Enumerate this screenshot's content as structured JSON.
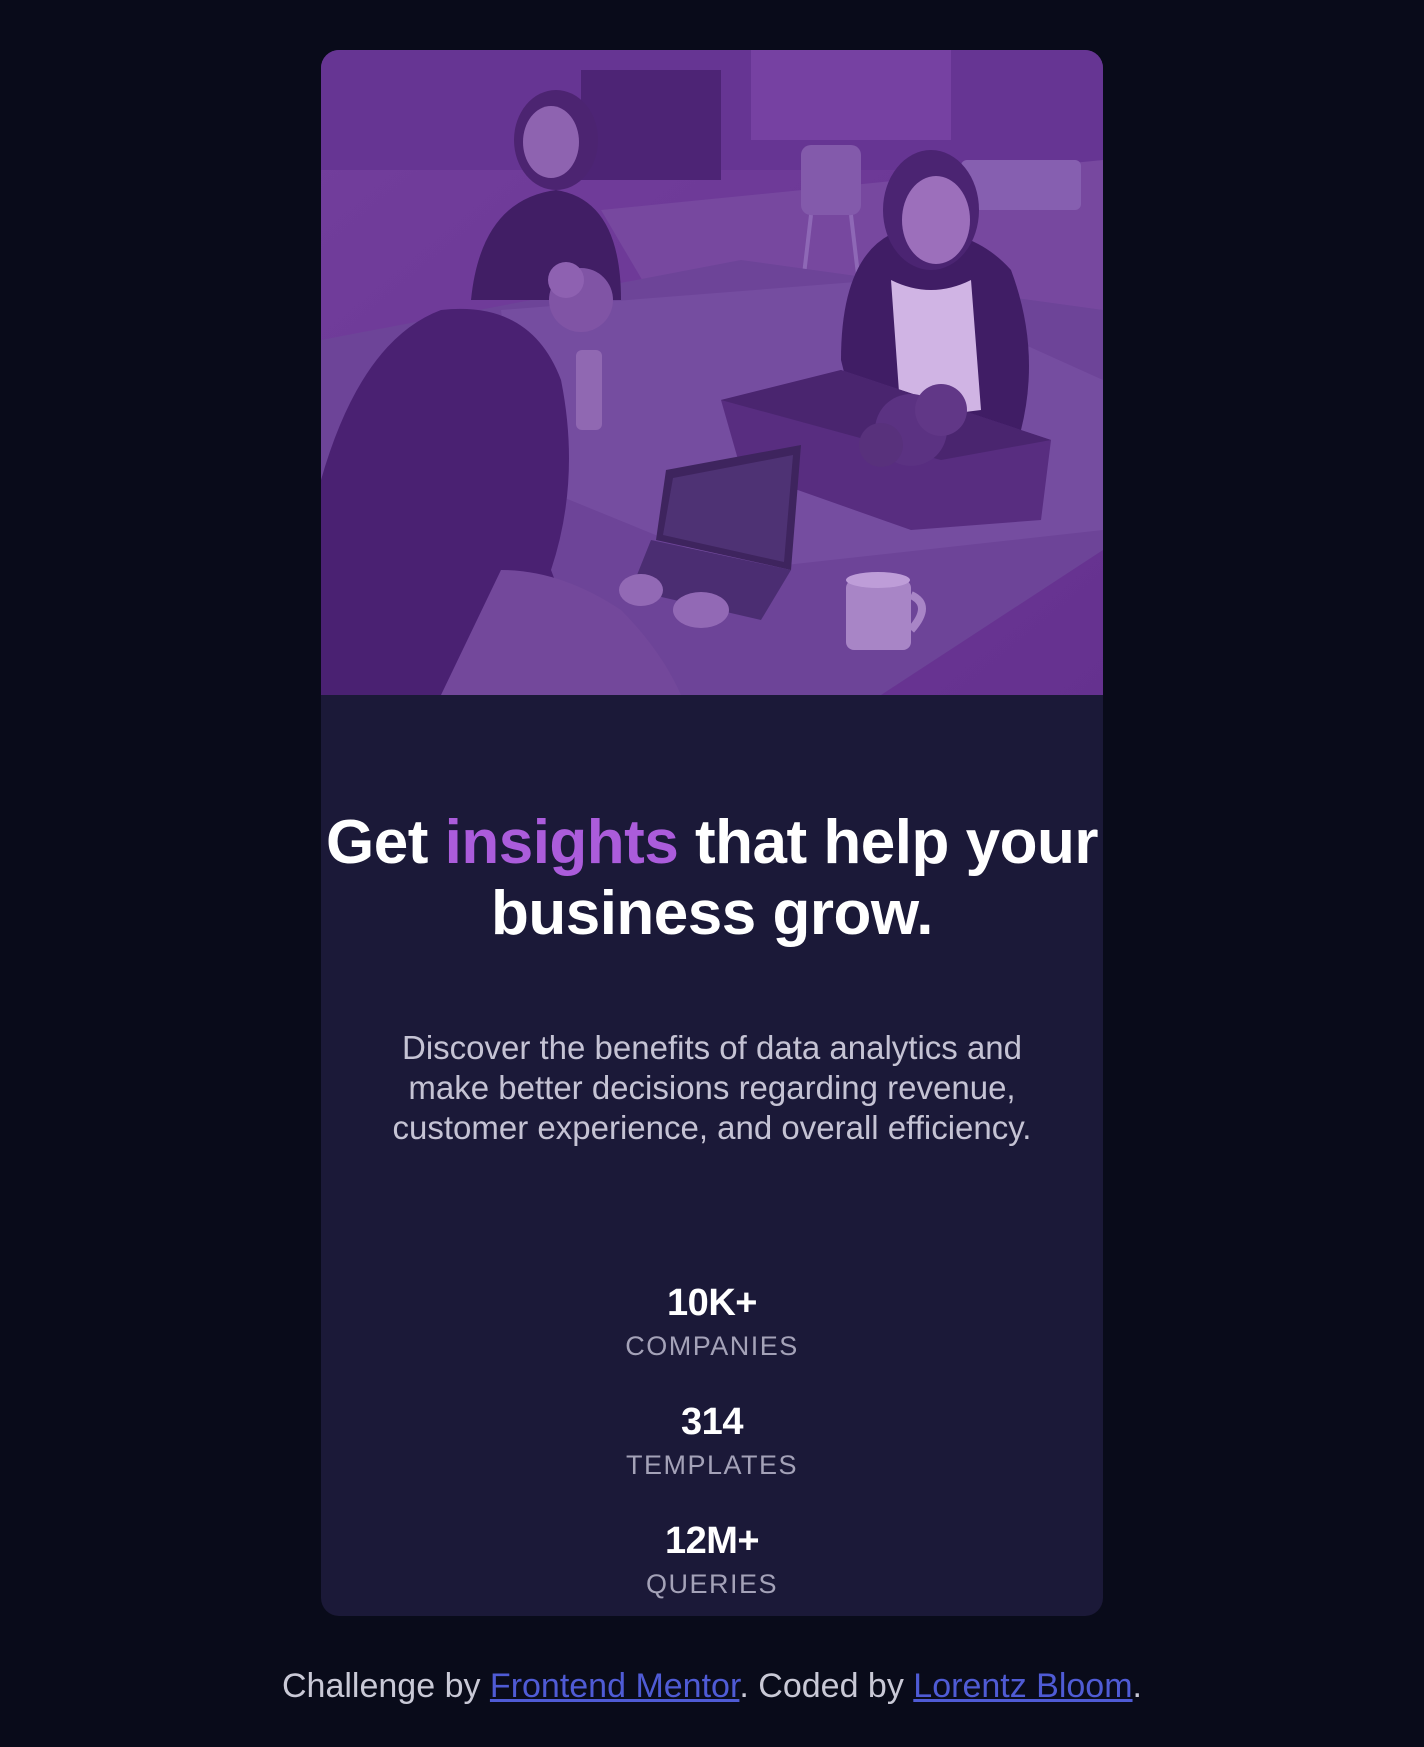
{
  "colors": {
    "page_background": "#090b1a",
    "card_background": "#1b1938",
    "accent": "#ab5cdb",
    "heading": "#ffffff",
    "body_text": "#c5c3d4",
    "stat_label": "#a4a2b8",
    "link": "#4f5bd5"
  },
  "hero": {
    "image_description_icon": "office-team-photo"
  },
  "headline": {
    "part1": "Get ",
    "accent": "insights",
    "part2": " that help your business grow."
  },
  "description": "Discover the benefits of data analytics and make better decisions regarding revenue, customer experience, and overall efficiency.",
  "stats": [
    {
      "value": "10K+",
      "label": "COMPANIES"
    },
    {
      "value": "314",
      "label": "TEMPLATES"
    },
    {
      "value": "12M+",
      "label": "QUERIES"
    }
  ],
  "footer": {
    "challenge_prefix": "Challenge by ",
    "challenge_link": "Frontend Mentor",
    "coded_prefix": ". Coded by ",
    "author_link": "Lorentz Bloom",
    "suffix": "."
  }
}
